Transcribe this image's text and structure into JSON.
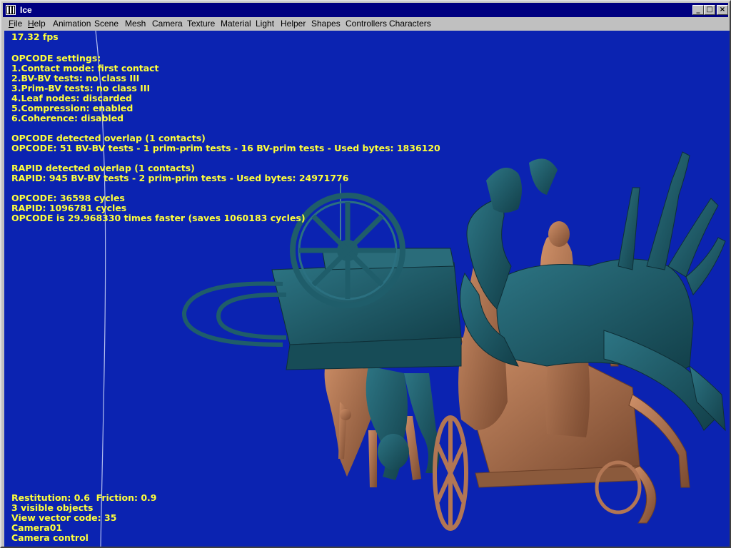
{
  "window": {
    "title": "Ice",
    "minimize_glyph": "_",
    "maximize_glyph": "□",
    "close_glyph": "×"
  },
  "menu": {
    "file": {
      "underline": "F",
      "rest": "ile"
    },
    "help": {
      "underline": "H",
      "rest": "elp"
    },
    "items": [
      "Animation",
      "Scene",
      "Mesh",
      "Camera",
      "Texture",
      "Material",
      "Light",
      "Helper",
      "Shapes",
      "Controllers",
      "Characters"
    ]
  },
  "hud": {
    "fps": "17.32 fps",
    "opcode_settings": {
      "heading": "OPCODE settings:",
      "lines": [
        "1.Contact mode: first contact",
        "2.BV-BV tests: no class III",
        "3.Prim-BV tests: no class III",
        "4.Leaf nodes: discarded",
        "5.Compression: enabled",
        "6.Coherence: disabled"
      ]
    },
    "opcode_overlap": "OPCODE detected overlap (1 contacts)",
    "opcode_stats": "OPCODE: 51 BV-BV tests - 1 prim-prim tests - 16 BV-prim tests - Used bytes: 1836120",
    "rapid_overlap": "RAPID detected overlap (1 contacts)",
    "rapid_stats": "RAPID: 945 BV-BV tests - 2 prim-prim tests - Used bytes: 24971776",
    "opcode_cycles": "OPCODE: 36598 cycles",
    "rapid_cycles": "RAPID: 1096781 cycles",
    "speedup": "OPCODE is 29.968330 times faster (saves 1060183 cycles)",
    "restitution": "Restitution: 0.6  Friction: 0.9",
    "visible_objects": "3 visible objects",
    "view_vector": "View vector code: 35",
    "camera_name": "Camera01",
    "camera_control": "Camera control"
  },
  "colors": {
    "viewport_bg": "#0b23b1",
    "hud_text": "#ffff3a",
    "teal_model": "#1f5d6a",
    "copper_model": "#b27654",
    "titlebar": "#000080"
  }
}
